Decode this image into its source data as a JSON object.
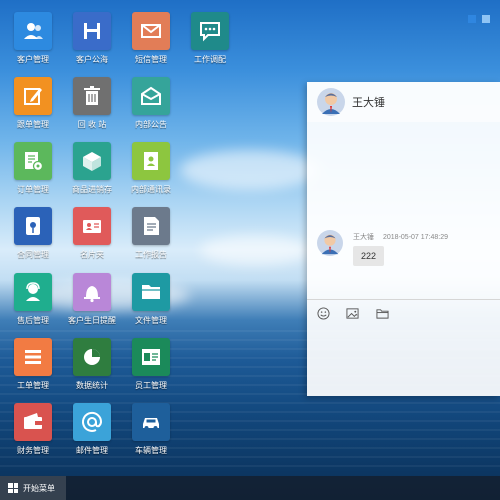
{
  "desktop": {
    "apps": [
      {
        "label": "客户管理",
        "icon": "contacts-icon",
        "color": "#2d8ae0"
      },
      {
        "label": "客户公海",
        "icon": "save-icon",
        "color": "#3a6cc9"
      },
      {
        "label": "短信管理",
        "icon": "mail-icon",
        "color": "#e27d57"
      },
      {
        "label": "工作调配",
        "icon": "chat-bubble-icon",
        "color": "#1f8a8a"
      },
      {
        "label": "跟单管理",
        "icon": "edit-icon",
        "color": "#f29121"
      },
      {
        "label": "回 收 站",
        "icon": "trash-icon",
        "color": "#707070"
      },
      {
        "label": "内部公告",
        "icon": "envelope-open-icon",
        "color": "#35a49a"
      },
      {
        "label": "订单管理",
        "icon": "order-icon",
        "color": "#5cb85c"
      },
      {
        "label": "商品进销存",
        "icon": "box-icon",
        "color": "#2ba38f"
      },
      {
        "label": "内部通讯录",
        "icon": "address-book-icon",
        "color": "#8dc63f"
      },
      {
        "label": "合同管理",
        "icon": "contract-icon",
        "color": "#2b62b8"
      },
      {
        "label": "名片夹",
        "icon": "business-card-icon",
        "color": "#e05a5a"
      },
      {
        "label": "工作报告",
        "icon": "report-icon",
        "color": "#6c7a8c"
      },
      {
        "label": "售后管理",
        "icon": "support-icon",
        "color": "#1fae8e"
      },
      {
        "label": "客户生日提醒",
        "icon": "bell-icon",
        "color": "#b987d8"
      },
      {
        "label": "文件管理",
        "icon": "folder-icon",
        "color": "#1e9aa3"
      },
      {
        "label": "工单管理",
        "icon": "list-icon",
        "color": "#f27b43"
      },
      {
        "label": "数据统计",
        "icon": "pie-chart-icon",
        "color": "#2f7d3f"
      },
      {
        "label": "员工管理",
        "icon": "employee-card-icon",
        "color": "#1b8a5a"
      },
      {
        "label": "财务管理",
        "icon": "wallet-icon",
        "color": "#d9534f"
      },
      {
        "label": "邮件管理",
        "icon": "at-sign-icon",
        "color": "#3ba3d9"
      },
      {
        "label": "车辆管理",
        "icon": "car-icon",
        "color": "#1e5f9b"
      }
    ]
  },
  "chat": {
    "contact_name": "王大锤",
    "messages": [
      {
        "sender": "王大锤",
        "time": "2018-05-07 17:48:29",
        "text": "222"
      }
    ],
    "tools": [
      "emoji-icon",
      "image-icon",
      "folder-icon"
    ]
  },
  "taskbar": {
    "start_label": "开始菜单"
  },
  "colors": {
    "accent": "#2f86e0",
    "taskbar": "#1e2a3a"
  }
}
